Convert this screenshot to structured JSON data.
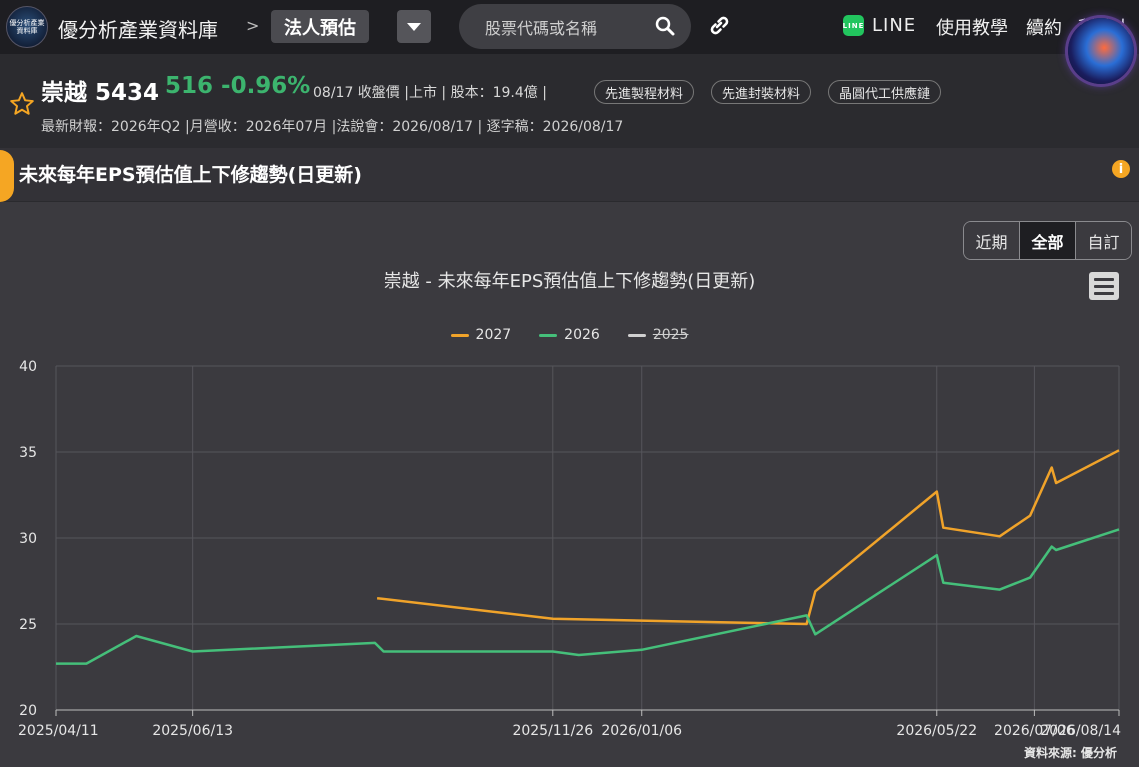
{
  "topbar": {
    "logo_text": "優分析產業資料庫",
    "site_name": "優分析產業資料庫",
    "breadcrumb_sep": ">",
    "breadcrumb_current": "法人預估",
    "search_placeholder": "股票代碼或名稱",
    "line_label": "LINE",
    "nav": [
      "使用教學",
      "續約",
      "甜達人"
    ]
  },
  "stock": {
    "name": "崇越 5434",
    "price_change": "516 -0.96%",
    "meta": "08/17 收盤價 |上市 | 股本：19.4億 |",
    "tags": [
      "先進製程材料",
      "先進封裝材料",
      "晶圓代工供應鏈"
    ],
    "sub": "最新財報：2026年Q2 |月營收：2026年07月 |法說會：2026/08/17 | 逐字稿：2026/08/17"
  },
  "section": {
    "title": "未來每年EPS預估值上下修趨勢(日更新)"
  },
  "range_buttons": [
    "近期",
    "全部",
    "自訂"
  ],
  "range_active": "全部",
  "colors": {
    "accent": "#f5a623",
    "series_2027": "#f0a32a",
    "series_2026": "#45bf7a",
    "series_2025": "#d0d0d0",
    "price_up": "#3cb46e"
  },
  "chart_data": {
    "type": "line",
    "title": "崇越 - 未來每年EPS預估值上下修趨勢(日更新)",
    "x_ticks": [
      "2025/04/11",
      "2025/06/13",
      "2025/11/26",
      "2026/01/06",
      "2026/05/22",
      "2026/07/06",
      "2026/08/14"
    ],
    "ylim": [
      20,
      40
    ],
    "y_ticks": [
      20,
      25,
      30,
      35,
      40
    ],
    "grid": true,
    "legend_position": "top-center",
    "series": [
      {
        "name": "2027",
        "visible": true,
        "points": [
          [
            "2025/09/06",
            26.5
          ],
          [
            "2025/11/26",
            25.3
          ],
          [
            "2026/03/23",
            25.0
          ],
          [
            "2026/03/27",
            26.9
          ],
          [
            "2026/05/22",
            32.7
          ],
          [
            "2026/05/25",
            30.6
          ],
          [
            "2026/06/20",
            30.1
          ],
          [
            "2026/07/04",
            31.3
          ],
          [
            "2026/07/14",
            34.1
          ],
          [
            "2026/07/16",
            33.2
          ],
          [
            "2026/08/14",
            35.1
          ]
        ]
      },
      {
        "name": "2026",
        "visible": true,
        "points": [
          [
            "2025/04/11",
            22.7
          ],
          [
            "2025/04/25",
            22.7
          ],
          [
            "2025/05/18",
            24.3
          ],
          [
            "2025/06/13",
            23.4
          ],
          [
            "2025/09/05",
            23.9
          ],
          [
            "2025/09/09",
            23.4
          ],
          [
            "2025/11/26",
            23.4
          ],
          [
            "2025/12/08",
            23.2
          ],
          [
            "2026/01/06",
            23.5
          ],
          [
            "2026/03/23",
            25.5
          ],
          [
            "2026/03/27",
            24.4
          ],
          [
            "2026/05/22",
            29.0
          ],
          [
            "2026/05/25",
            27.4
          ],
          [
            "2026/06/20",
            27.0
          ],
          [
            "2026/07/04",
            27.7
          ],
          [
            "2026/07/14",
            29.5
          ],
          [
            "2026/07/16",
            29.3
          ],
          [
            "2026/08/14",
            30.5
          ]
        ]
      },
      {
        "name": "2025",
        "visible": false,
        "points": []
      }
    ],
    "source": "資料來源: 優分析"
  }
}
